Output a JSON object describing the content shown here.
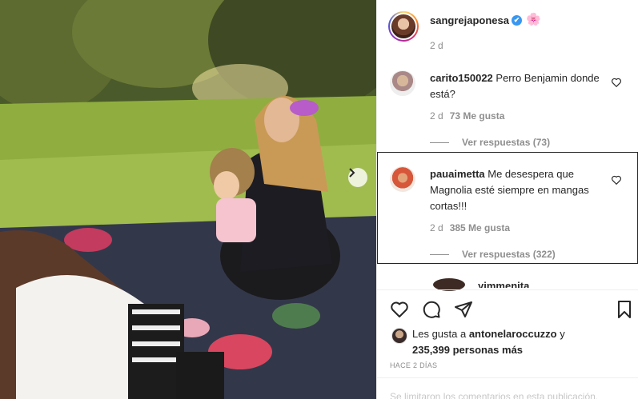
{
  "post": {
    "username": "sangrejaponesa",
    "verified_mark": "✔",
    "emoji": "🌸",
    "age": "2 d"
  },
  "photo": {
    "description_icon": "photo",
    "next_icon": "chevron-right-icon"
  },
  "comments": [
    {
      "username": "carito150022",
      "text": "Perro Benjamin donde está?",
      "age": "2 d",
      "likes": "73 Me gusta",
      "replies": "Ver respuestas (73)"
    },
    {
      "username": "pauaimetta",
      "text": "Me desespera que Magnolia esté siempre en mangas cortas!!!",
      "age": "2 d",
      "likes": "385 Me gusta",
      "replies": "Ver respuestas (322)"
    }
  ],
  "partial_comment": {
    "username": "yimmenita"
  },
  "actions": {
    "like_icon": "heart-icon",
    "comment_icon": "comment-icon",
    "share_icon": "share-icon",
    "save_icon": "bookmark-icon"
  },
  "likes": {
    "prefix": "Les gusta a ",
    "first_user": "antonelaroccuzzo",
    "connector": " y",
    "others": "235,399 personas más"
  },
  "timestamp": "HACE 2 DÍAS",
  "comments_limited": "Se limitaron los comentarios en esta publicación.",
  "colors": {
    "verified": "#3897f0",
    "text": "#262626",
    "secondary": "#8e8e8e"
  }
}
